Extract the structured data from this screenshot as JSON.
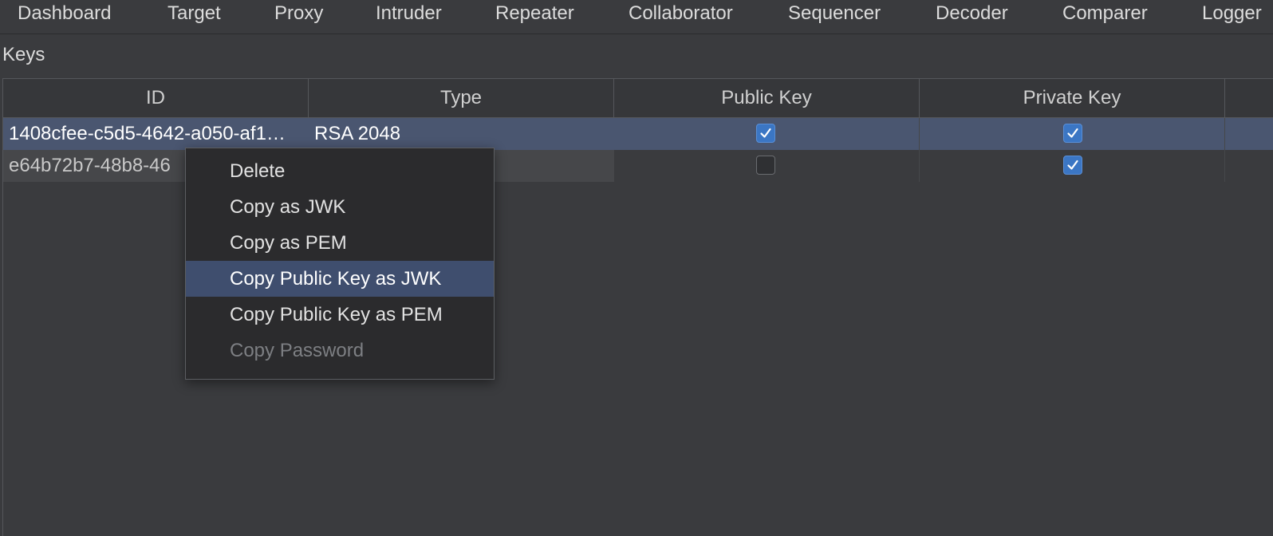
{
  "tabs": [
    {
      "label": "Dashboard"
    },
    {
      "label": "Target"
    },
    {
      "label": "Proxy"
    },
    {
      "label": "Intruder"
    },
    {
      "label": "Repeater"
    },
    {
      "label": "Collaborator"
    },
    {
      "label": "Sequencer"
    },
    {
      "label": "Decoder"
    },
    {
      "label": "Comparer"
    },
    {
      "label": "Logger"
    }
  ],
  "section": {
    "title": "Keys"
  },
  "table": {
    "columns": [
      "ID",
      "Type",
      "Public Key",
      "Private Key"
    ],
    "rows": [
      {
        "id": "1408cfee-c5d5-4642-a050-af1…",
        "type": "RSA 2048",
        "public_key": true,
        "private_key": true,
        "selected": true
      },
      {
        "id": "e64b72b7-48b8-46",
        "type": "",
        "public_key": false,
        "private_key": true,
        "selected": false
      }
    ]
  },
  "context_menu": {
    "items": [
      {
        "label": "Delete",
        "enabled": true
      },
      {
        "label": "Copy as JWK",
        "enabled": true
      },
      {
        "label": "Copy as PEM",
        "enabled": true
      },
      {
        "label": "Copy Public Key as JWK",
        "enabled": true,
        "highlighted": true
      },
      {
        "label": "Copy Public Key as PEM",
        "enabled": true
      },
      {
        "label": "Copy Password",
        "enabled": false
      }
    ]
  },
  "colors": {
    "background": "#3a3b3e",
    "selected_row": "#4a5670",
    "menu_highlight": "#3f4e6e",
    "checkbox_checked": "#3b76c4"
  },
  "icons": {
    "checked": "checkmark-icon"
  }
}
